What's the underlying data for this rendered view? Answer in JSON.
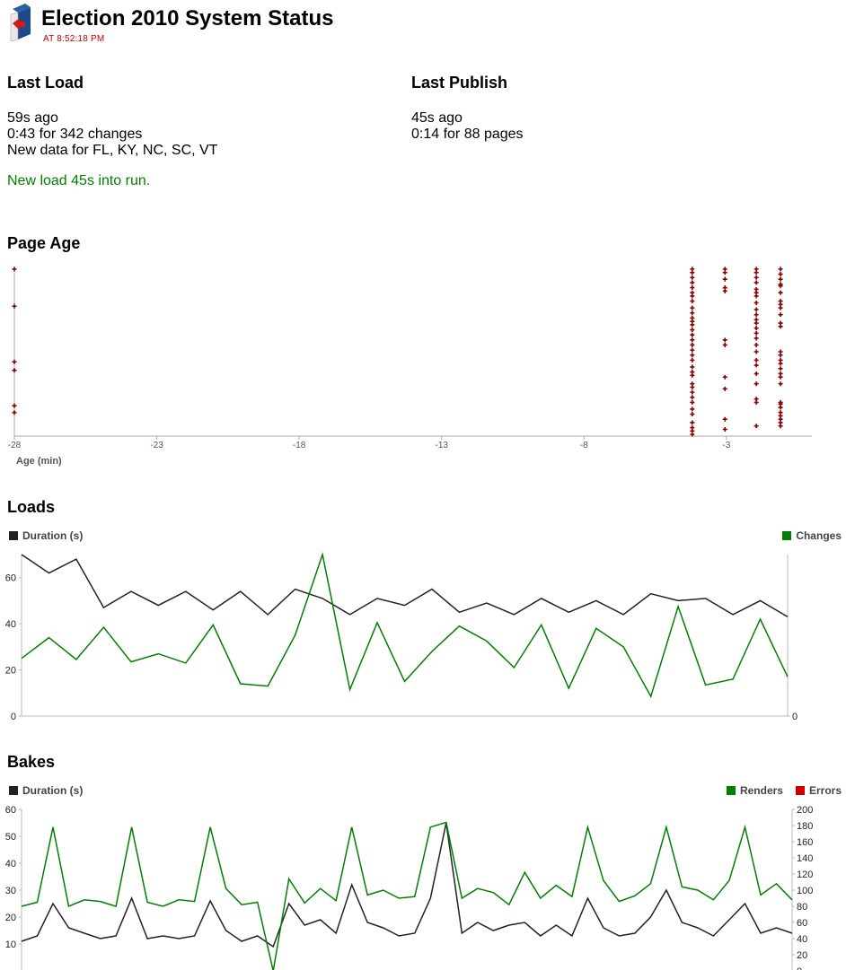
{
  "header": {
    "title": "Election 2010 System Status",
    "subtitle": "AT 8:52:18 PM"
  },
  "last_load": {
    "heading": "Last Load",
    "ago": "59s ago",
    "stats": "0:43 for 342 changes",
    "states": "New data for FL, KY, NC, SC, VT",
    "note": "New load 45s into run."
  },
  "last_publish": {
    "heading": "Last Publish",
    "ago": "45s ago",
    "stats": "0:14 for 88 pages"
  },
  "colors": {
    "duration": "#222222",
    "changes": "#008000",
    "renders": "#008000",
    "errors": "#cc0000",
    "page_age_marker": "#8b0000",
    "status_red": "#c00000"
  },
  "sections": {
    "page_age": "Page Age",
    "loads": "Loads",
    "bakes": "Bakes"
  },
  "chart_data": [
    {
      "id": "page_age",
      "type": "scatter",
      "title": "Page Age",
      "xlabel": "Age (min)",
      "ylabel": "",
      "xlim": [
        -28,
        0
      ],
      "xticks": [
        -28,
        -23,
        -18,
        -13,
        -8,
        -3
      ],
      "ylim": [
        0,
        1
      ],
      "series": [
        {
          "marker": "plus",
          "x": [
            -28,
            -28,
            -28,
            -28,
            -28,
            -28,
            -4.2,
            -4.2,
            -4.2,
            -4.2,
            -4.2,
            -4.2,
            -4.2,
            -4.2,
            -4.2,
            -4.2,
            -4.2,
            -4.2,
            -4.2,
            -4.2,
            -4.2,
            -4.2,
            -4.2,
            -4.2,
            -4.2,
            -4.2,
            -4.2,
            -4.2,
            -4.2,
            -4.2,
            -4.2,
            -4.2,
            -4.2,
            -4.2,
            -4.2,
            -4.2,
            -4.2,
            -4.2,
            -4.2,
            -4.2,
            -3.05,
            -3.05,
            -3.05,
            -3.05,
            -3.05,
            -3.05,
            -3.05,
            -3.05,
            -3.05,
            -3.05,
            -3.05,
            -1.95,
            -1.95,
            -1.95,
            -1.95,
            -1.95,
            -1.95,
            -1.95,
            -1.95,
            -1.95,
            -1.95,
            -1.95,
            -1.95,
            -1.95,
            -1.95,
            -1.95,
            -1.95,
            -1.95,
            -1.95,
            -1.95,
            -1.95,
            -1.95,
            -1.95,
            -1.95,
            -1.95,
            -1.1,
            -1.1,
            -1.1,
            -1.1,
            -1.1,
            -1.1,
            -1.1,
            -1.1,
            -1.1,
            -1.1,
            -1.1,
            -1.1,
            -1.1,
            -1.1,
            -1.1,
            -1.1,
            -1.1,
            -1.1,
            -1.1,
            -1.1,
            -1.1,
            -1.1,
            -1.1,
            -1.1,
            -1.1,
            -1.1,
            -1.1,
            -1.1
          ],
          "y": [
            0.99,
            0.77,
            0.44,
            0.39,
            0.18,
            0.14,
            0.99,
            0.97,
            0.94,
            0.91,
            0.88,
            0.85,
            0.83,
            0.8,
            0.76,
            0.73,
            0.7,
            0.66,
            0.63,
            0.6,
            0.57,
            0.54,
            0.51,
            0.48,
            0.45,
            0.41,
            0.38,
            0.31,
            0.29,
            0.26,
            0.23,
            0.2,
            0.16,
            0.13,
            0.08,
            0.05,
            0.03,
            0.01,
            0.36,
            0.68,
            0.99,
            0.97,
            0.93,
            0.88,
            0.86,
            0.57,
            0.54,
            0.35,
            0.28,
            0.1,
            0.04,
            0.99,
            0.97,
            0.94,
            0.91,
            0.87,
            0.83,
            0.79,
            0.75,
            0.72,
            0.67,
            0.64,
            0.61,
            0.58,
            0.54,
            0.5,
            0.45,
            0.42,
            0.37,
            0.31,
            0.22,
            0.2,
            0.06,
            0.85,
            0.69,
            0.99,
            0.96,
            0.93,
            0.89,
            0.85,
            0.8,
            0.78,
            0.76,
            0.67,
            0.65,
            0.5,
            0.45,
            0.43,
            0.4,
            0.37,
            0.35,
            0.31,
            0.2,
            0.17,
            0.14,
            0.12,
            0.1,
            0.08,
            0.06,
            0.9,
            0.72,
            0.48,
            0.19
          ]
        }
      ]
    },
    {
      "id": "loads",
      "type": "line",
      "title": "Loads",
      "xlabel": "",
      "ylabel": "",
      "ylim": [
        0,
        70
      ],
      "yticks_left": [
        0,
        20,
        40,
        60
      ],
      "yticks_right": [
        0
      ],
      "legend": [
        "Duration (s)",
        "Changes"
      ],
      "series": [
        {
          "name": "Duration (s)",
          "axis": "left",
          "values": [
            70,
            62,
            68,
            47,
            54,
            48,
            54,
            46,
            54,
            44,
            55,
            51,
            44,
            51,
            48,
            55,
            45,
            49,
            44,
            51,
            45,
            50,
            44,
            53,
            50,
            51,
            44,
            50,
            43
          ]
        },
        {
          "name": "Changes",
          "axis": "right",
          "values": [
            25,
            34,
            24.5,
            38.5,
            23.5,
            27,
            23,
            39.5,
            14,
            13,
            35,
            70,
            11.5,
            40.5,
            15,
            28,
            39,
            32.5,
            21,
            39.5,
            12,
            38,
            30,
            8.5,
            47.5,
            13.5,
            16,
            42,
            17
          ]
        }
      ]
    },
    {
      "id": "bakes",
      "type": "line",
      "title": "Bakes",
      "xlabel": "",
      "ylabel": "",
      "ylim_left": [
        0,
        60
      ],
      "ylim_right": [
        0,
        200
      ],
      "yticks_left": [
        10,
        20,
        30,
        40,
        50,
        60
      ],
      "yticks_right": [
        0,
        20,
        40,
        60,
        80,
        100,
        120,
        140,
        160,
        180,
        200
      ],
      "legend": [
        "Duration (s)",
        "Renders",
        "Errors"
      ],
      "series": [
        {
          "name": "Duration (s)",
          "axis": "left",
          "values": [
            11,
            13,
            25,
            16,
            14,
            12,
            13,
            27,
            12,
            13,
            12,
            13,
            26,
            15,
            11,
            13,
            9,
            25,
            17,
            19,
            14,
            32,
            18,
            16,
            13,
            14,
            27,
            55,
            14,
            18,
            15,
            17,
            18,
            13,
            17,
            13,
            27,
            16,
            13,
            14,
            20,
            30,
            18,
            16,
            13,
            19,
            25,
            14,
            16,
            14
          ]
        },
        {
          "name": "Renders",
          "axis": "right",
          "values": [
            80,
            85,
            178,
            80,
            88,
            86,
            80,
            178,
            85,
            80,
            88,
            86,
            178,
            102,
            82,
            85,
            0,
            114,
            84,
            102,
            87,
            178,
            94,
            100,
            90,
            92,
            178,
            184,
            90,
            102,
            97,
            82,
            122,
            90,
            106,
            92,
            178,
            112,
            86,
            93,
            108,
            178,
            104,
            100,
            88,
            112,
            178,
            94,
            108,
            88
          ]
        },
        {
          "name": "Errors",
          "axis": "right",
          "values": []
        }
      ]
    }
  ]
}
